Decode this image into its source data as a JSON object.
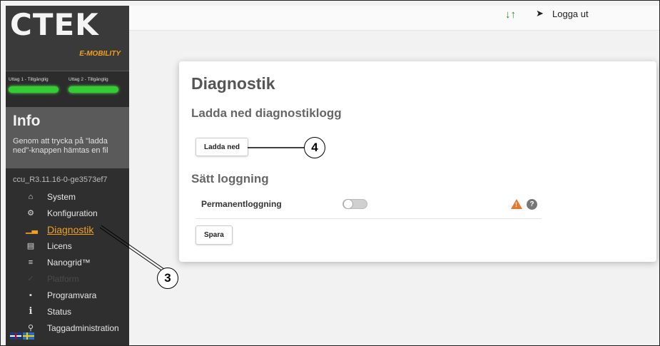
{
  "sidebar": {
    "logo": "CTEK",
    "logo_sub": "E-MOBILITY",
    "outlets": [
      {
        "label": "Uttag 1 - Tillgänglig"
      },
      {
        "label": "Uttag 2 - Tillgänglig"
      }
    ],
    "info": {
      "title": "Info",
      "text": "Genom att trycka på \"ladda ned\"-knappen hämtas en fil"
    },
    "version": "ccu_R3.11.16-0-ge3573ef7",
    "items": [
      {
        "label": "System",
        "icon": "home-icon"
      },
      {
        "label": "Konfiguration",
        "icon": "gear-icon"
      },
      {
        "label": "Diagnostik",
        "icon": "chart-icon"
      },
      {
        "label": "Licens",
        "icon": "license-icon"
      },
      {
        "label": "Nanogrid™",
        "icon": "sliders-icon"
      },
      {
        "label": "Platform",
        "icon": "wrench-icon"
      },
      {
        "label": "Programvara",
        "icon": "folder-icon"
      },
      {
        "label": "Status",
        "icon": "info-icon"
      },
      {
        "label": "Taggadministration",
        "icon": "key-icon"
      }
    ]
  },
  "topbar": {
    "logout_label": "Logga ut"
  },
  "card": {
    "title": "Diagnostik",
    "download_section": {
      "title": "Ladda ned diagnostiklogg",
      "button_label": "Ladda ned"
    },
    "logging_section": {
      "title": "Sätt loggning",
      "permanent_label": "Permanentloggning",
      "toggle_on": false,
      "save_label": "Spara"
    }
  },
  "callouts": {
    "download": "4",
    "diagnostik": "3"
  },
  "colors": {
    "accent": "#f0a020",
    "outlet_available": "#33cc33",
    "warning": "#e8762a"
  }
}
